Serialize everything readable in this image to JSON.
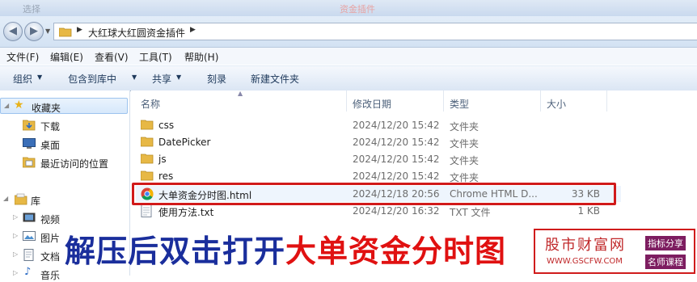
{
  "topstrip": {
    "left_text": "选择",
    "red_text": "资金插件"
  },
  "address": {
    "path": "大红球大红圆资金插件"
  },
  "menu": [
    "文件(F)",
    "编辑(E)",
    "查看(V)",
    "工具(T)",
    "帮助(H)"
  ],
  "commands": {
    "organize": "组织",
    "include": "包含到库中",
    "share": "共享",
    "burn": "刻录",
    "new_folder": "新建文件夹"
  },
  "nav": {
    "favorites": "收藏夹",
    "downloads": "下载",
    "desktop": "桌面",
    "recent": "最近访问的位置",
    "libraries": "库",
    "videos": "视频",
    "pictures": "图片",
    "documents": "文档",
    "music": "音乐"
  },
  "columns": {
    "name": "名称",
    "modified": "修改日期",
    "type": "类型",
    "size": "大小"
  },
  "files": [
    {
      "name": "css",
      "date": "2024/12/20 15:42",
      "type": "文件夹",
      "size": "",
      "icon": "folder-icon"
    },
    {
      "name": "DatePicker",
      "date": "2024/12/20 15:42",
      "type": "文件夹",
      "size": "",
      "icon": "folder-icon"
    },
    {
      "name": "js",
      "date": "2024/12/20 15:42",
      "type": "文件夹",
      "size": "",
      "icon": "folder-icon"
    },
    {
      "name": "res",
      "date": "2024/12/20 15:42",
      "type": "文件夹",
      "size": "",
      "icon": "folder-icon"
    },
    {
      "name": "大单资金分时图.html",
      "date": "2024/12/18 20:56",
      "type": "Chrome HTML D...",
      "size": "33 KB",
      "icon": "chrome-icon"
    },
    {
      "name": "使用方法.txt",
      "date": "2024/12/20 16:32",
      "type": "TXT 文件",
      "size": "1 KB",
      "icon": "text-file-icon"
    }
  ],
  "banner": {
    "part1": "解压后双击打开",
    "part2": "大单资金分时图"
  },
  "watermark": {
    "site": "股市财富网",
    "url": "WWW.GSCFW.COM",
    "tag1": "指标分享",
    "tag2": "名师课程"
  },
  "colors": {
    "highlight": "#d11a1a",
    "banner_blue": "#1a2e9c",
    "banner_red": "#e01111"
  }
}
